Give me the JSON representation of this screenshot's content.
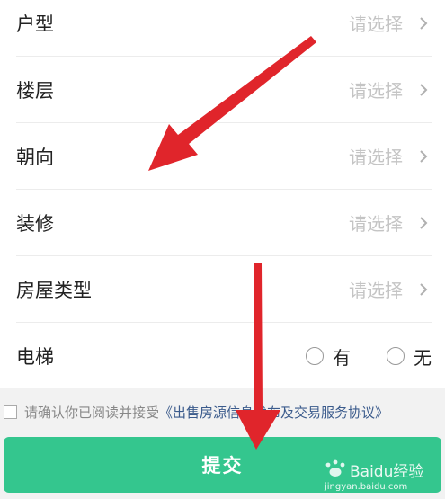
{
  "form": {
    "rows": [
      {
        "label": "户型",
        "value": "请选择"
      },
      {
        "label": "楼层",
        "value": "请选择"
      },
      {
        "label": "朝向",
        "value": "请选择"
      },
      {
        "label": "装修",
        "value": "请选择"
      },
      {
        "label": "房屋类型",
        "value": "请选择"
      }
    ],
    "elevator": {
      "label": "电梯",
      "option_yes": "有",
      "option_no": "无"
    }
  },
  "agreement": {
    "prefix": "请确认你已阅读并接受",
    "link": "《出售房源信息发布及交易服务协议》"
  },
  "submit": {
    "label": "提交"
  },
  "watermark": {
    "brand": "Baidu经验",
    "url": "jingyan.baidu.com"
  },
  "colors": {
    "accent": "#34c68e",
    "link": "#3b5b8c",
    "arrow": "#e0252b"
  }
}
